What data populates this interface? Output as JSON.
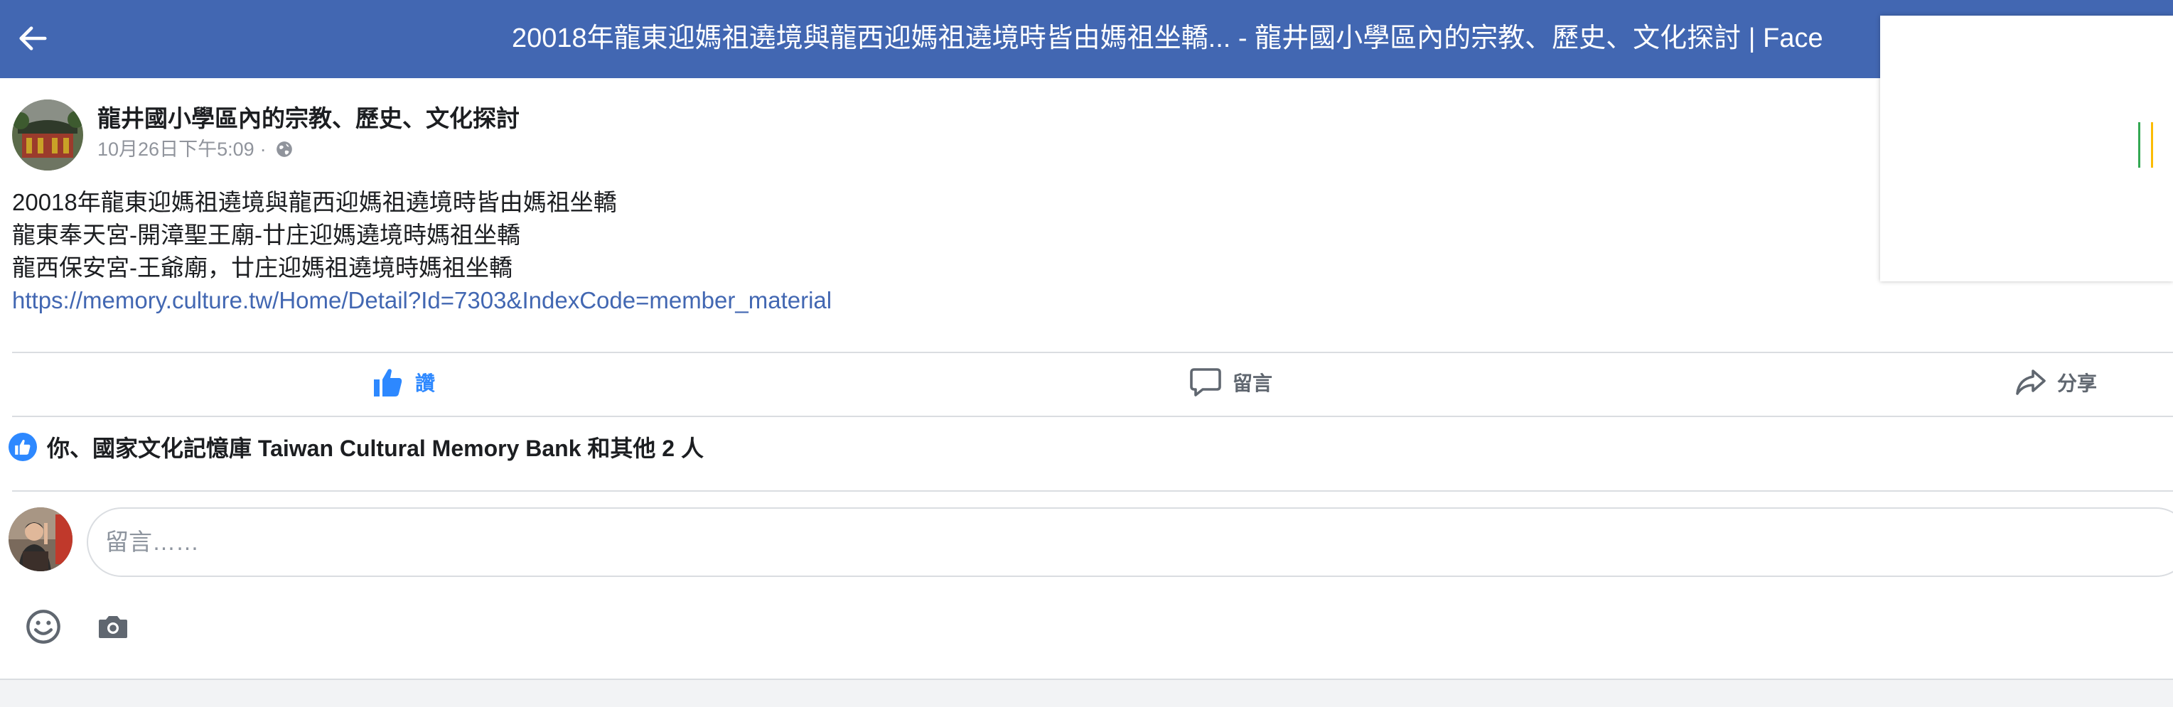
{
  "topbar": {
    "title": "20018年龍東迎媽祖遶境與龍西迎媽祖遶境時皆由媽祖坐轎... - 龍井國小學區內的宗教、歷史、文化探討 | Face",
    "background_color": "#4267b2"
  },
  "post": {
    "page_name": "龍井國小學區內的宗教、歷史、文化探討",
    "timestamp": "10月26日下午5:09",
    "separator": "·",
    "audience_icon": "globe-icon",
    "lines": [
      "20018年龍東迎媽祖遶境與龍西迎媽祖遶境時皆由媽祖坐轎",
      "龍東奉天宮-開漳聖王廟-廿庄迎媽遶境時媽祖坐轎",
      "龍西保安宮-王爺廟，廿庄迎媽祖遶境時媽祖坐轎"
    ],
    "link": "https://memory.culture.tw/Home/Detail?Id=7303&IndexCode=member_material"
  },
  "actions": {
    "like_label": "讚",
    "comment_label": "留言",
    "share_label": "分享",
    "like_color": "#2d88ff"
  },
  "reactions": {
    "text": "你、國家文化記憶庫 Taiwan Cultural Memory Bank 和其他 2 人"
  },
  "composer": {
    "placeholder": "留言……"
  },
  "overlay": {
    "accent_colors": [
      "#34a853",
      "#fbbc05"
    ]
  }
}
